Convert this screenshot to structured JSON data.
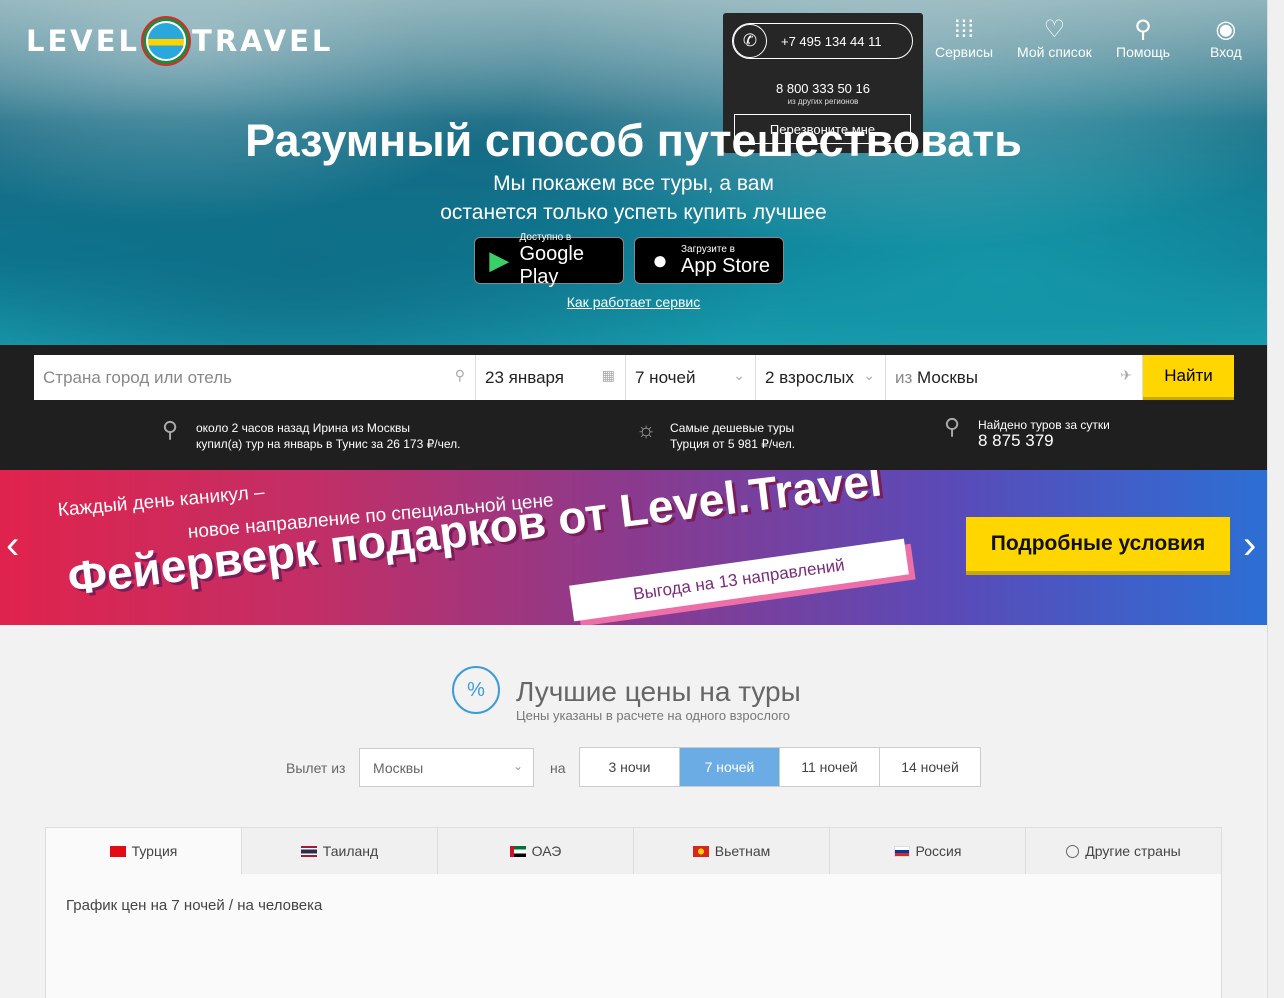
{
  "header": {
    "logo_left": "LEVEL",
    "logo_right": "TRAVEL",
    "phone_main": "+7 495 134 44 11",
    "phone_alt": "8 800 333 50 16",
    "phone_alt_note": "из других регионов",
    "callback_label": "Перезвоните мне",
    "nav": [
      {
        "label": "Сервисы",
        "icon": "grid-icon"
      },
      {
        "label": "Мой список",
        "icon": "heart-icon"
      },
      {
        "label": "Помощь",
        "icon": "help-icon"
      },
      {
        "label": "Вход",
        "icon": "user-icon"
      }
    ]
  },
  "hero": {
    "title": "Разумный способ путешествовать",
    "subtitle_line1": "Мы покажем все туры, а вам",
    "subtitle_line2": "останется только успеть купить лучшее",
    "google_small": "Доступно в",
    "google_big": "Google Play",
    "apple_small": "Загрузите в",
    "apple_big": "App Store",
    "how_link": "Как работает сервис"
  },
  "search": {
    "destination_placeholder": "Страна город или отель",
    "date": "23 января",
    "nights": "7 ночей",
    "guests": "2 взрослых",
    "from_prefix": "из",
    "from_city": "Москвы",
    "find_label": "Найти"
  },
  "info": {
    "recent_line1": "около 2 часов назад Ирина из Москвы",
    "recent_line2": "купил(а) тур на январь в Тунис за 26 173 ₽/чел.",
    "cheap_title": "Самые дешевые туры",
    "cheap_text": "Турция от 5 981 ₽/чел.",
    "found_title": "Найдено туров за сутки",
    "found_count": "8 875 379"
  },
  "banner": {
    "line1": "Каждый день каникул –",
    "line2": "новое направление по специальной цене",
    "headline": "Фейерверк подарков от Level.Travel",
    "ribbon": "Выгода на 13 направлений",
    "button": "Подробные условия"
  },
  "best_prices": {
    "title": "Лучшие цены на туры",
    "subtitle": "Цены указаны в расчете на одного взрослого",
    "departure_label": "Вылет из",
    "departure_value": "Москвы",
    "on_label": "на",
    "nights_options": [
      "3 ночи",
      "7 ночей",
      "11 ночей",
      "14 ночей"
    ],
    "active_nights": "7 ночей",
    "tabs": [
      {
        "label": "Турция"
      },
      {
        "label": "Таиланд"
      },
      {
        "label": "ОАЭ"
      },
      {
        "label": "Вьетнам"
      },
      {
        "label": "Россия"
      },
      {
        "label": "Другие страны"
      }
    ],
    "chart_title": "График цен на 7 ночей / на человека"
  },
  "colors": {
    "accent_yellow": "#ffd600",
    "active_tab_blue": "#6cace4",
    "dark_band": "#1f1f1f"
  }
}
